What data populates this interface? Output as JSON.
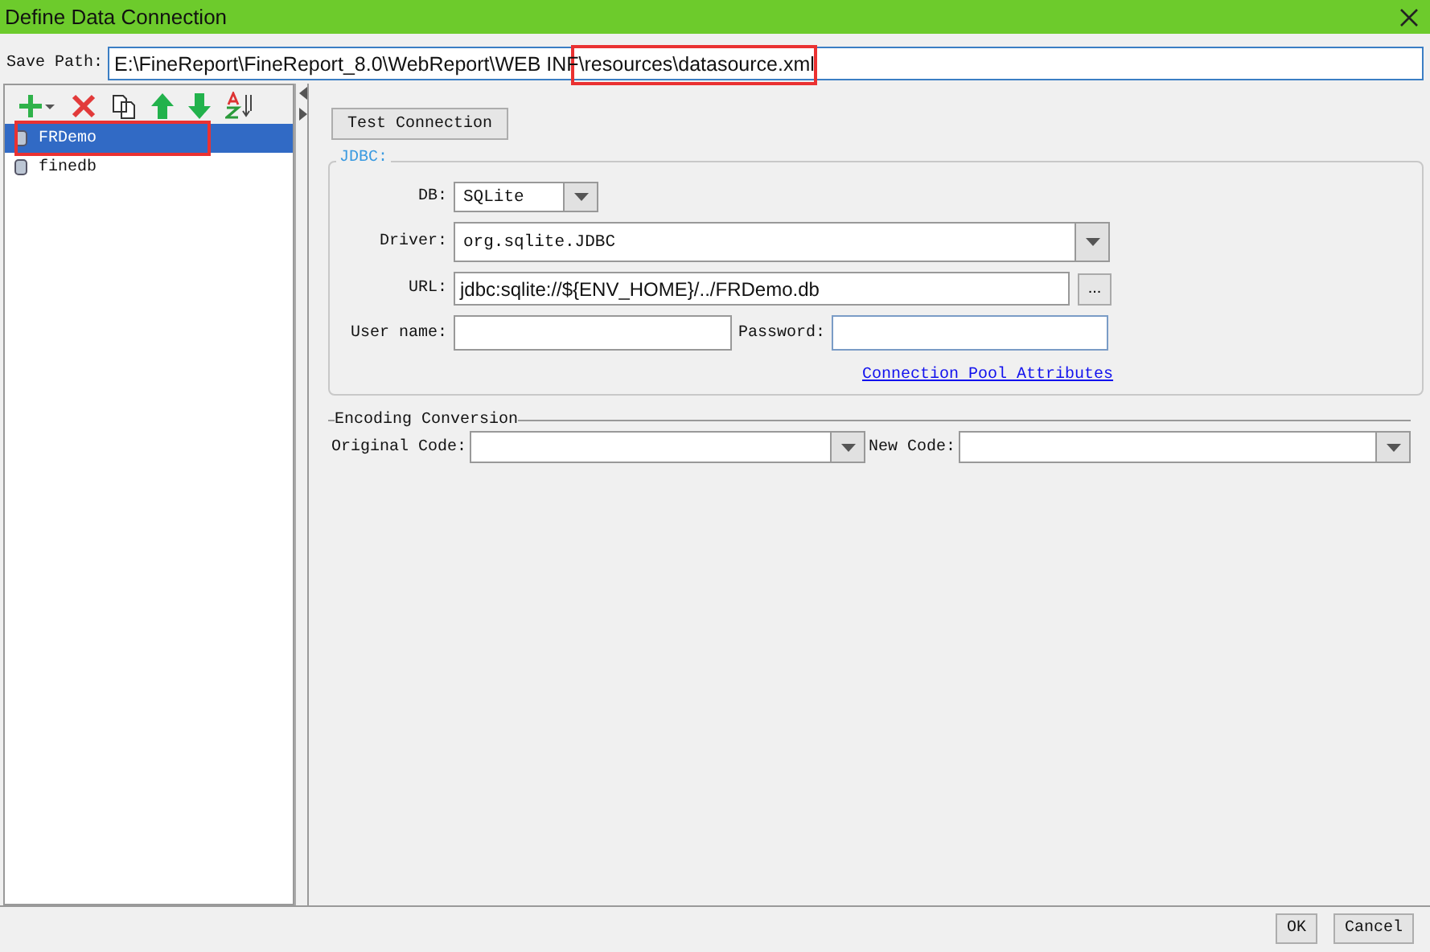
{
  "window": {
    "title": "Define Data Connection"
  },
  "save_path": {
    "label": "Save Path:",
    "value": "E:\\FineReport\\FineReport_8.0\\WebReport\\WEB INF\\resources\\datasource.xml"
  },
  "connections": [
    {
      "name": "FRDemo",
      "selected": true
    },
    {
      "name": "finedb",
      "selected": false
    }
  ],
  "test_button": "Test Connection",
  "jdbc": {
    "title": "JDBC:",
    "db": {
      "label": "DB:",
      "value": "SQLite"
    },
    "driver": {
      "label": "Driver:",
      "value": "org.sqlite.JDBC"
    },
    "url": {
      "label": "URL:",
      "value": "jdbc:sqlite://${ENV_HOME}/../FRDemo.db"
    },
    "url_button": "...",
    "username": {
      "label": "User name:"
    },
    "password": {
      "label": "Password:"
    },
    "pool_link": "Connection Pool Attributes"
  },
  "encoding": {
    "title": "Encoding Conversion",
    "original": {
      "label": "Original Code:"
    },
    "new": {
      "label": "New Code:"
    }
  },
  "buttons": [
    "OK",
    "Cancel"
  ]
}
